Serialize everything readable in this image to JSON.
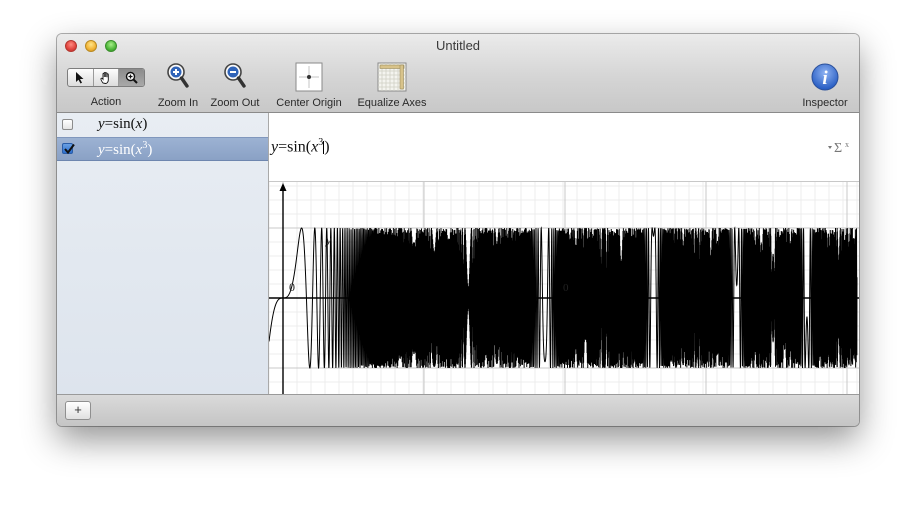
{
  "window": {
    "title": "Untitled"
  },
  "toolbar": {
    "action_label": "Action",
    "zoom_in_label": "Zoom In",
    "zoom_out_label": "Zoom Out",
    "center_origin_label": "Center Origin",
    "equalize_axes_label": "Equalize Axes",
    "inspector_label": "Inspector"
  },
  "equations": [
    {
      "lhs": "y",
      "eq": "=sin(",
      "var": "x",
      "exp": "",
      "close": ")",
      "checked": false,
      "selected": false
    },
    {
      "lhs": "y",
      "eq": "=sin(",
      "var": "x",
      "exp": "3",
      "close": ")",
      "checked": true,
      "selected": true
    }
  ],
  "editor": {
    "lhs": "y",
    "eq": "=sin(",
    "var": "x",
    "exp": "3",
    "close": ")"
  },
  "graph": {
    "origin_label": "0",
    "y_axis_label": "y",
    "x_tick_label": "0"
  },
  "bottombar": {
    "add_symbol": "+"
  }
}
